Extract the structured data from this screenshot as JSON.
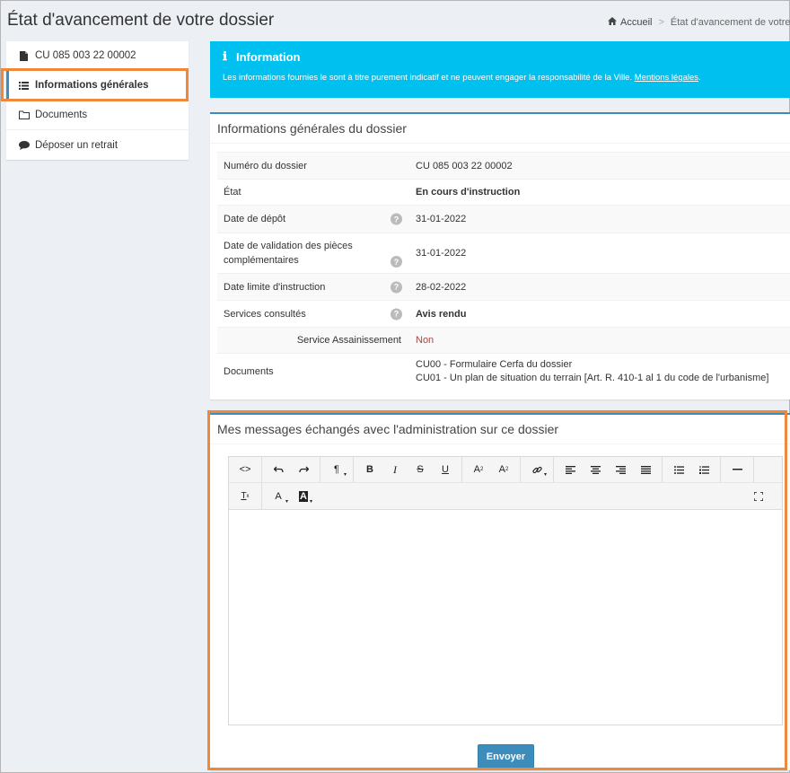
{
  "header": {
    "title": "État d'avancement de votre dossier",
    "breadcrumb": {
      "home": "Accueil",
      "current": "État d'avancement de votre doss"
    }
  },
  "sidebar": {
    "items": [
      {
        "label": "CU 085 003 22 00002",
        "icon": "file-icon"
      },
      {
        "label": "Informations générales",
        "icon": "list-icon"
      },
      {
        "label": "Documents",
        "icon": "folder-icon"
      },
      {
        "label": "Déposer un retrait",
        "icon": "comment-icon"
      }
    ]
  },
  "callout": {
    "title": "Information",
    "text": "Les informations fournies le sont à titre purement indicatif et ne peuvent engager la responsabilité de la Ville.",
    "link": "Mentions légales",
    "color": "#00c0ef"
  },
  "dossier": {
    "title": "Informations générales du dossier",
    "rows": [
      {
        "label": "Numéro du dossier",
        "value": "CU 085 003 22 00002"
      },
      {
        "label": "État",
        "value": "En cours d'instruction"
      },
      {
        "label": "Date de dépôt",
        "value": "31-01-2022"
      },
      {
        "label": "Date de validation des pièces complémentaires",
        "value": "31-01-2022"
      },
      {
        "label": "Date limite d'instruction",
        "value": "28-02-2022"
      },
      {
        "label": "Services consultés",
        "value": "Avis rendu"
      },
      {
        "label": "Service Assainissement",
        "value": "Non"
      },
      {
        "label": "Documents",
        "values": [
          "CU00 - Formulaire Cerfa du dossier",
          "CU01 - Un plan de situation du terrain [Art. R. 410-1 al 1 du code de l'urbanisme]"
        ]
      }
    ]
  },
  "messages": {
    "title": "Mes messages échangés avec l'administration sur ce dossier",
    "send_label": "Envoyer",
    "editor_content": ""
  },
  "colors": {
    "accent": "#3c8dbc",
    "highlight": "#f0883a",
    "negative": "#a94442"
  }
}
